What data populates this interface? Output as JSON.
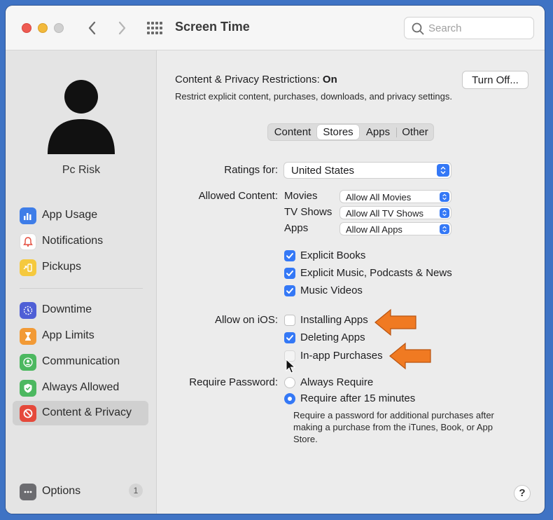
{
  "colors": {
    "accent": "#3478f6",
    "annotation_arrow": "#f07a22",
    "background": "#3f73c4"
  },
  "titlebar": {
    "title": "Screen Time",
    "search_placeholder": "Search",
    "icons": [
      "back-chevron-icon",
      "forward-chevron-icon",
      "grid-icon",
      "search-icon"
    ]
  },
  "sidebar": {
    "user_name": "Pc Risk",
    "items": [
      {
        "label": "App Usage",
        "icon": "bar-chart-icon"
      },
      {
        "label": "Notifications",
        "icon": "bell-icon"
      },
      {
        "label": "Pickups",
        "icon": "pickup-icon"
      },
      {
        "label": "Downtime",
        "icon": "downtime-icon"
      },
      {
        "label": "App Limits",
        "icon": "hourglass-icon"
      },
      {
        "label": "Communication",
        "icon": "person-icon"
      },
      {
        "label": "Always Allowed",
        "icon": "checkmark-shield-icon"
      },
      {
        "label": "Content & Privacy",
        "icon": "no-entry-icon",
        "selected": true
      }
    ],
    "options": {
      "label": "Options",
      "badge": "1"
    }
  },
  "main": {
    "title_prefix": "Content & Privacy Restrictions:",
    "title_state": "On",
    "description": "Restrict explicit content, purchases, downloads, and privacy settings.",
    "turn_off_label": "Turn Off...",
    "tabs": [
      "Content",
      "Stores",
      "Apps",
      "Other"
    ],
    "active_tab": "Stores",
    "ratings_label": "Ratings for:",
    "ratings_value": "United States",
    "allowed_content_label": "Allowed Content:",
    "allowed_content": [
      {
        "label": "Movies",
        "value": "Allow All Movies"
      },
      {
        "label": "TV Shows",
        "value": "Allow All TV Shows"
      },
      {
        "label": "Apps",
        "value": "Allow All Apps"
      }
    ],
    "content_checks": [
      {
        "label": "Explicit Books",
        "checked": true
      },
      {
        "label": "Explicit Music, Podcasts & News",
        "checked": true
      },
      {
        "label": "Music Videos",
        "checked": true
      }
    ],
    "allow_ios_label": "Allow on iOS:",
    "ios_checks": [
      {
        "label": "Installing Apps",
        "checked": false
      },
      {
        "label": "Deleting Apps",
        "checked": true
      },
      {
        "label": "In-app Purchases",
        "checked": false
      }
    ],
    "require_password_label": "Require Password:",
    "password_options": [
      {
        "label": "Always Require",
        "selected": false
      },
      {
        "label": "Require after 15 minutes",
        "selected": true
      }
    ],
    "password_note": "Require a password for additional purchases after making a purchase from the iTunes, Book, or App Store.",
    "help_label": "?"
  }
}
